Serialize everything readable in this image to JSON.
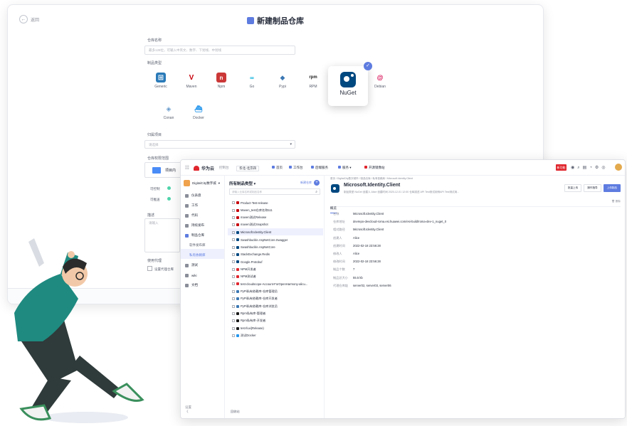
{
  "wizard": {
    "back_label": "返回",
    "title": "新建制品仓库",
    "name_label": "仓库名称",
    "name_placeholder": "最多128位，可输入中英文、数字、下划线、中划线",
    "type_label": "制品类型",
    "types": [
      "Generic",
      "Maven",
      "Npm",
      "Go",
      "Pypi",
      "RPM",
      "NuGet",
      "Debian",
      "Conan",
      "Docker"
    ],
    "scan_label": "归属项目",
    "scan_placeholder": "请选择",
    "scope_label": "仓库权限范围",
    "scope_option": "项目内",
    "perm_rows": [
      "可控制",
      "可推送"
    ],
    "desc_label": "描述",
    "desc_placeholder": "请输入",
    "proxy_label": "使用代理",
    "proxy_option": "设置代理仓库"
  },
  "topbar": {
    "brand": "华为云",
    "region": "控制台",
    "project_tag": "华北-北京四",
    "nav": [
      "首页",
      "工作台",
      "后端服务",
      "服务",
      "开源镜像站"
    ],
    "new_tag": "新功能"
  },
  "leftnav": {
    "project_name": "DigitalCity数字城",
    "items": [
      "仪表盘",
      "工作",
      "代码",
      "持续发布",
      "制品仓库",
      "软件发布库",
      "私有依赖库",
      "测试",
      "wiki",
      "文档"
    ],
    "footer": [
      "设置",
      "《"
    ]
  },
  "repolist": {
    "header": "所有制品类型",
    "header_action": "新建仓库",
    "search_placeholder": "请输入仓库名称或制品名称",
    "repos": [
      {
        "name": "Product-Test-release",
        "color": "#c7000b"
      },
      {
        "name": "Maven_test仓库名称111",
        "color": "#c7000b"
      },
      {
        "name": "maven测试Release",
        "color": "#c7000b"
      },
      {
        "name": "maven测试Snapshot",
        "color": "#c7000b"
      },
      {
        "name": "Microsoft.Identity.Client",
        "color": "#004880"
      },
      {
        "name": "Swashbuckle.AspNetCore.Swagger",
        "color": "#004880"
      },
      {
        "name": "Swashbuckle.AspNetCore",
        "color": "#004880"
      },
      {
        "name": "StackExchange.Redis",
        "color": "#004880"
      },
      {
        "name": "Google.Protobuf",
        "color": "#004880"
      },
      {
        "name": "NPM开发者",
        "color": "#e0262d"
      },
      {
        "name": "NPM测试者",
        "color": "#e0262d"
      },
      {
        "name": "test-cloudscope-Account-ForOpenHarmony-alicu...",
        "color": "#e0262d"
      },
      {
        "name": "PyPi私有依赖库-仓库管理员",
        "color": "#3b77b3"
      },
      {
        "name": "PyPi私有依赖库-仓库开发者",
        "color": "#3b77b3"
      },
      {
        "name": "PyPi私有依赖库-仓库浏览员",
        "color": "#3b77b3"
      },
      {
        "name": "Rpm私有库-管理者",
        "color": "#1a1a1a"
      },
      {
        "name": "Rpm私有库-开发者",
        "color": "#1a1a1a"
      },
      {
        "name": "test-fuxi(Release)",
        "color": "#1a1a1a"
      },
      {
        "name": "测试Docker",
        "color": "#2496ed"
      }
    ],
    "selected_index": 4,
    "footer": "回收站"
  },
  "detail": {
    "breadcrumb": "首页 / DigitalCity数字城市 / 制品仓库 / 私有依赖库 / Microsoft.Identity.Client",
    "title": "Microsoft.Identity.Client",
    "meta": "制品类型 NuGet   创建人 Alice   创建时间 2020-12-01 12:00   仓库描述 API Test测试用例API Test测试用...",
    "actions": [
      "批量上传",
      "操作指导",
      "上传制品"
    ],
    "tab": "概览",
    "delete_label": "删除",
    "props": [
      {
        "k": "名称",
        "v": "Microsoft.Identity.Client"
      },
      {
        "k": "仓库地址",
        "v": "devrepo-devcloud-roma.esi.huawei.com/esi-build/roma-dev-1_nuget_0"
      },
      {
        "k": "相对路径",
        "v": "Microsoft.Identity.Client"
      },
      {
        "k": "创建人",
        "v": "Alice"
      },
      {
        "k": "创建时间",
        "v": "2022-02-18 23:56:28"
      },
      {
        "k": "修改人",
        "v": "Alice"
      },
      {
        "k": "修改时间",
        "v": "2022-02-18 23:56:28"
      },
      {
        "k": "制品个数",
        "v": "7"
      },
      {
        "k": "制品总大小",
        "v": "55.5 kb"
      },
      {
        "k": "代理仓库链",
        "v": "server02, server03, server06"
      }
    ]
  }
}
